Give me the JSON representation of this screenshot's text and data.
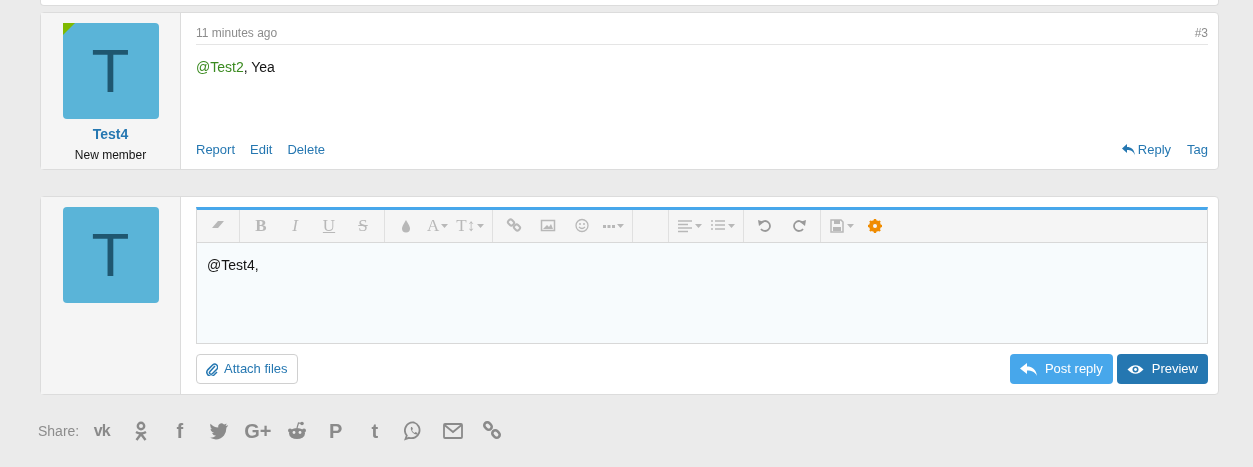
{
  "post": {
    "avatar_letter": "T",
    "online": true,
    "username": "Test4",
    "user_title": "New member",
    "time": "11 minutes ago",
    "number": "#3",
    "message": {
      "mention": "@Test2",
      "text": ", Yea"
    },
    "actions_left": [
      "Report",
      "Edit",
      "Delete"
    ],
    "actions_right": [
      {
        "kind": "reply",
        "label": "Reply"
      },
      {
        "kind": "plain",
        "label": "Tag"
      }
    ]
  },
  "reply_box": {
    "avatar_letter": "T",
    "toolbar": [
      [
        {
          "kind": "eraser"
        }
      ],
      [
        {
          "kind": "bold",
          "glyph": "B"
        },
        {
          "kind": "italic",
          "glyph": "I"
        },
        {
          "kind": "underline",
          "glyph": "U"
        },
        {
          "kind": "strike",
          "glyph": "S"
        }
      ],
      [
        {
          "kind": "drop"
        },
        {
          "kind": "letter",
          "glyph": "A",
          "dropdown": true
        },
        {
          "kind": "letter",
          "glyph": "T↕",
          "dropdown": true
        }
      ],
      [
        {
          "kind": "link"
        },
        {
          "kind": "image"
        },
        {
          "kind": "smile"
        },
        {
          "kind": "more",
          "dropdown": true
        }
      ],
      [
        {
          "kind": "align",
          "dropdown": true
        },
        {
          "kind": "list",
          "dropdown": true
        }
      ],
      [
        {
          "kind": "undo"
        },
        {
          "kind": "redo"
        }
      ],
      [
        {
          "kind": "save",
          "dropdown": true
        },
        {
          "kind": "gear"
        }
      ]
    ],
    "value": "@Test4,",
    "attach_label": "Attach files",
    "buttons": [
      {
        "kind": "post",
        "label": "Post reply"
      },
      {
        "kind": "preview",
        "label": "Preview"
      }
    ]
  },
  "share": {
    "label": "Share:",
    "items": [
      {
        "kind": "vk",
        "glyph": "vk"
      },
      {
        "kind": "ok"
      },
      {
        "kind": "glyph",
        "glyph": "f"
      },
      {
        "kind": "twitter"
      },
      {
        "kind": "glyph",
        "glyph": "G+"
      },
      {
        "kind": "reddit"
      },
      {
        "kind": "glyph",
        "glyph": "P"
      },
      {
        "kind": "glyph",
        "glyph": "t"
      },
      {
        "kind": "whatsapp"
      },
      {
        "kind": "email"
      },
      {
        "kind": "link"
      }
    ]
  }
}
